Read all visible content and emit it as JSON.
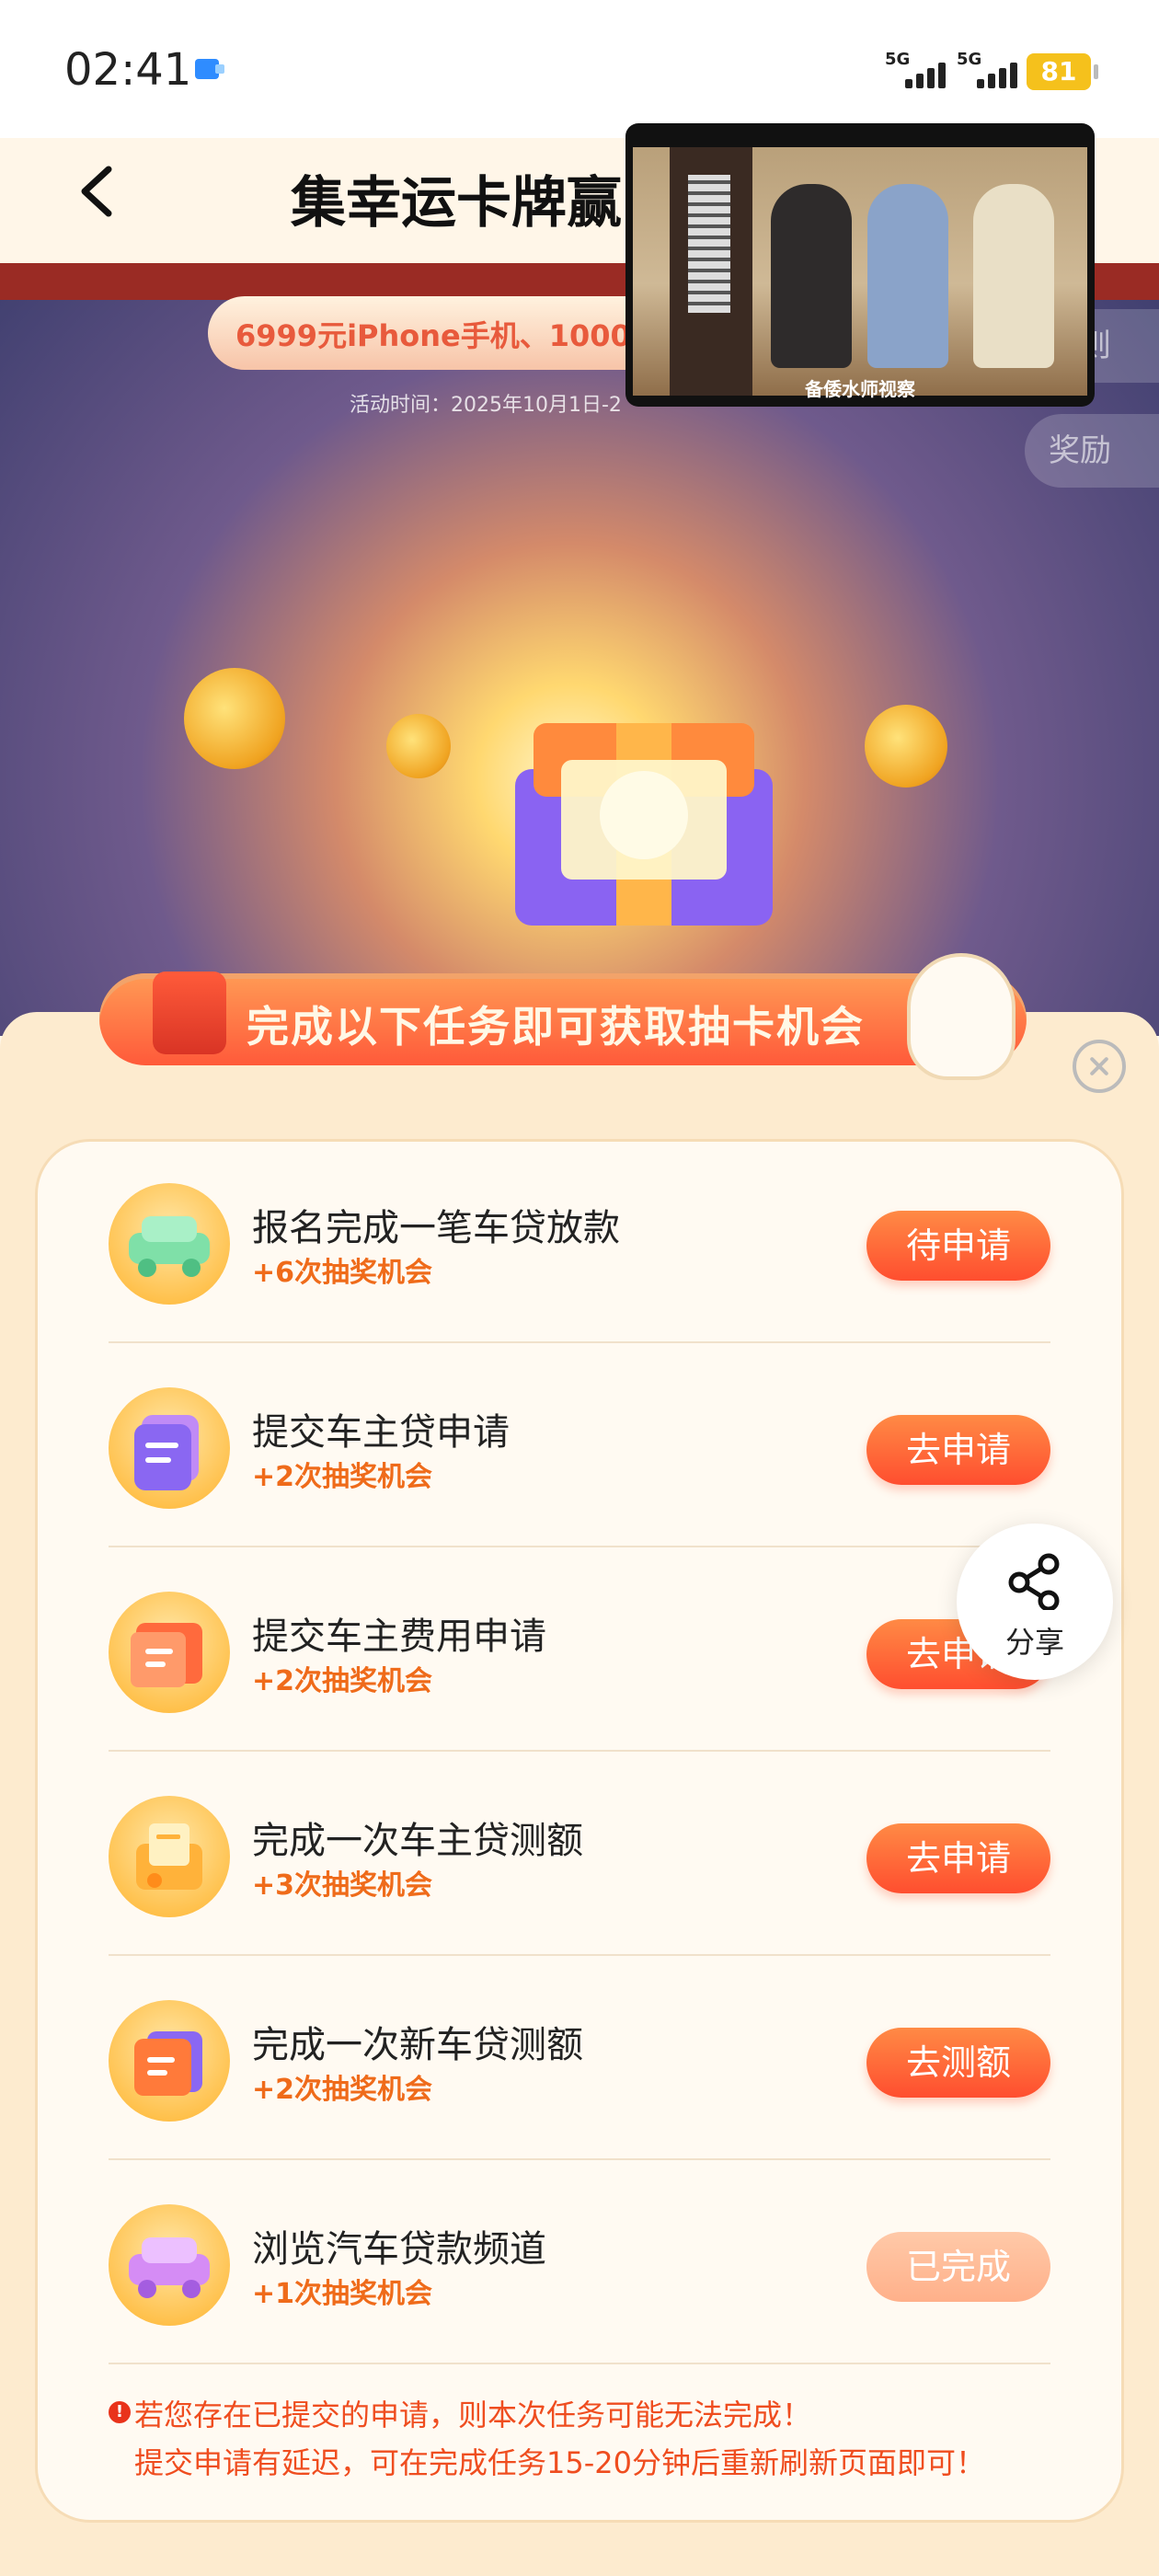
{
  "status_bar": {
    "time": "02:41",
    "signal1_label": "5G",
    "signal2_label": "5G",
    "battery": "81"
  },
  "header": {
    "title": "集幸运卡牌赢"
  },
  "video": {
    "caption": "备倭水师视察"
  },
  "banner": {
    "prize_text": "6999元iPhone手机、1000",
    "date_text": "活动时间：2025年10月1日-2",
    "rules_label": "规则",
    "reward_label": "奖励"
  },
  "task_banner": {
    "text": "完成以下任务即可获取抽卡机会"
  },
  "tasks": [
    {
      "title": "报名完成一笔车贷放款",
      "reward": "+6次抽奖机会",
      "button": "待申请",
      "icon": "car-icon",
      "done": false
    },
    {
      "title": "提交车主贷申请",
      "reward": "+2次抽奖机会",
      "button": "去申请",
      "icon": "cards-icon",
      "done": false
    },
    {
      "title": "提交车主费用申请",
      "reward": "+2次抽奖机会",
      "button": "去申请",
      "icon": "document-icon",
      "done": false
    },
    {
      "title": "完成一次车主贷测额",
      "reward": "+3次抽奖机会",
      "button": "去申请",
      "icon": "envelope-icon",
      "done": false
    },
    {
      "title": "完成一次新车贷测额",
      "reward": "+2次抽奖机会",
      "button": "去测额",
      "icon": "cards-icon",
      "done": false
    },
    {
      "title": "浏览汽车贷款频道",
      "reward": "+1次抽奖机会",
      "button": "已完成",
      "icon": "car-icon",
      "done": true
    }
  ],
  "share": {
    "label": "分享"
  },
  "notice": {
    "line1": "若您存在已提交的申请，则本次任务可能无法完成！",
    "line2": "提交申请有延迟，可在完成任务15-20分钟后重新刷新页面即可！"
  },
  "colors": {
    "accent": "#ff5a3a",
    "reward_text": "#ef6b1a",
    "notice_text": "#ef4d1f"
  }
}
